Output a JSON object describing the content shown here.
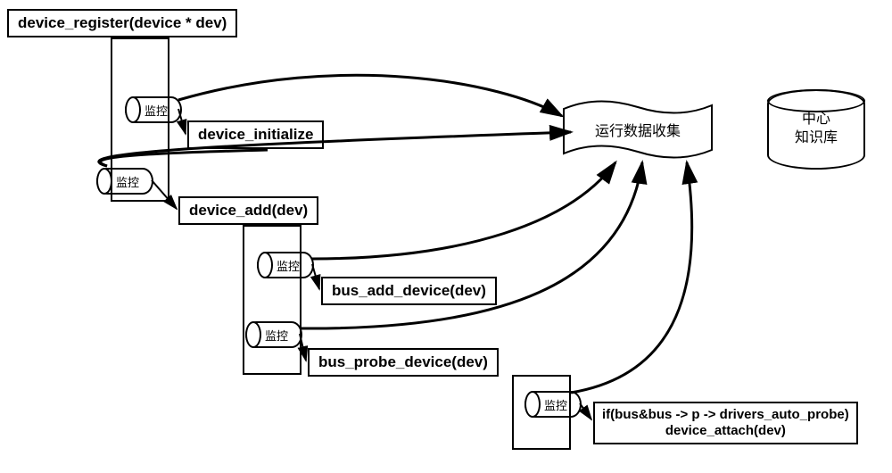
{
  "nodes": {
    "register": "device_register(device * dev)",
    "initialize": "device_initialize",
    "add": "device_add(dev)",
    "bus_add": "bus_add_device(dev)",
    "bus_probe": "bus_probe_device(dev)",
    "attach_line1": "if(bus&bus -> p -> drivers_auto_probe)",
    "attach_line2": "device_attach(dev)"
  },
  "monitor_label": "监控",
  "collector_label": "运行数据收集",
  "kb_line1": "中心",
  "kb_line2": "知识库"
}
